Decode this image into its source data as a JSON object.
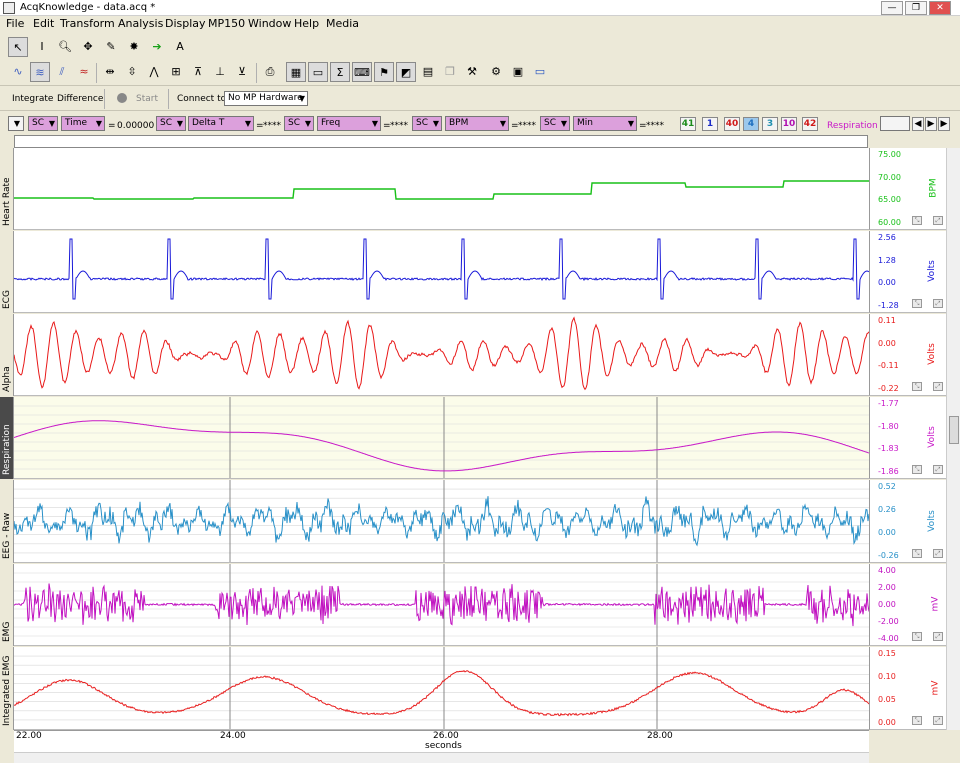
{
  "app": {
    "title": "AcqKnowledge - data.acq *"
  },
  "window_buttons": [
    "—",
    "❐",
    "✕"
  ],
  "menu": [
    "File",
    "Edit",
    "Transform",
    "Analysis",
    "Display",
    "MP150",
    "Window",
    "Help",
    "Media"
  ],
  "toolbar2": {
    "integrate": "Integrate",
    "difference": "Difference",
    "start": "Start",
    "connect_to": "Connect to:",
    "hardware": "No MP Hardware"
  },
  "measurements": [
    {
      "chan": "SC",
      "func": "Time",
      "value": "0.00000 sec"
    },
    {
      "chan": "SC",
      "func": "Delta T",
      "value": "****"
    },
    {
      "chan": "SC",
      "func": "Freq",
      "value": "****"
    },
    {
      "chan": "SC",
      "func": "BPM",
      "value": "****"
    },
    {
      "chan": "SC",
      "func": "Min",
      "value": "****"
    }
  ],
  "equals": "=",
  "channel_buttons": [
    {
      "label": "41",
      "color": "#1c8c1c"
    },
    {
      "label": "1",
      "color": "#1c2cc8"
    },
    {
      "label": "40",
      "color": "#d01818"
    },
    {
      "label": "4",
      "color": "#2070c0"
    },
    {
      "label": "3",
      "color": "#2090b0"
    },
    {
      "label": "10",
      "color": "#b010b0"
    },
    {
      "label": "42",
      "color": "#d01818"
    }
  ],
  "selected_channel_label": "Respiration",
  "channels": [
    {
      "name": "Heart Rate",
      "unit": "BPM",
      "color": "#18c018",
      "ticks": [
        "75.00",
        "70.00",
        "65.00",
        "60.00"
      ]
    },
    {
      "name": "ECG",
      "unit": "Volts",
      "color": "#1818d8",
      "ticks": [
        "2.56",
        "1.28",
        "0.00",
        "-1.28"
      ]
    },
    {
      "name": "Alpha",
      "unit": "Volts",
      "color": "#e81818",
      "ticks": [
        "0.11",
        "0.00",
        "-0.11",
        "-0.22"
      ]
    },
    {
      "name": "Respiration",
      "unit": "Volts",
      "color": "#c818c8",
      "ticks": [
        "-1.77",
        "-1.80",
        "-1.83",
        "-1.86"
      ]
    },
    {
      "name": "EEG - Raw",
      "unit": "Volts",
      "color": "#2890c8",
      "ticks": [
        "0.52",
        "0.26",
        "0.00",
        "-0.26"
      ]
    },
    {
      "name": "EMG",
      "unit": "mV",
      "color": "#c010c0",
      "ticks": [
        "4.00",
        "2.00",
        "0.00",
        "-2.00",
        "-4.00"
      ]
    },
    {
      "name": "Integrated EMG",
      "unit": "mV",
      "color": "#e82020",
      "ticks": [
        "0.15",
        "0.10",
        "0.05",
        "0.00"
      ]
    }
  ],
  "x_axis": {
    "ticks": [
      "22.00",
      "24.00",
      "26.00",
      "28.00"
    ],
    "label": "seconds"
  }
}
